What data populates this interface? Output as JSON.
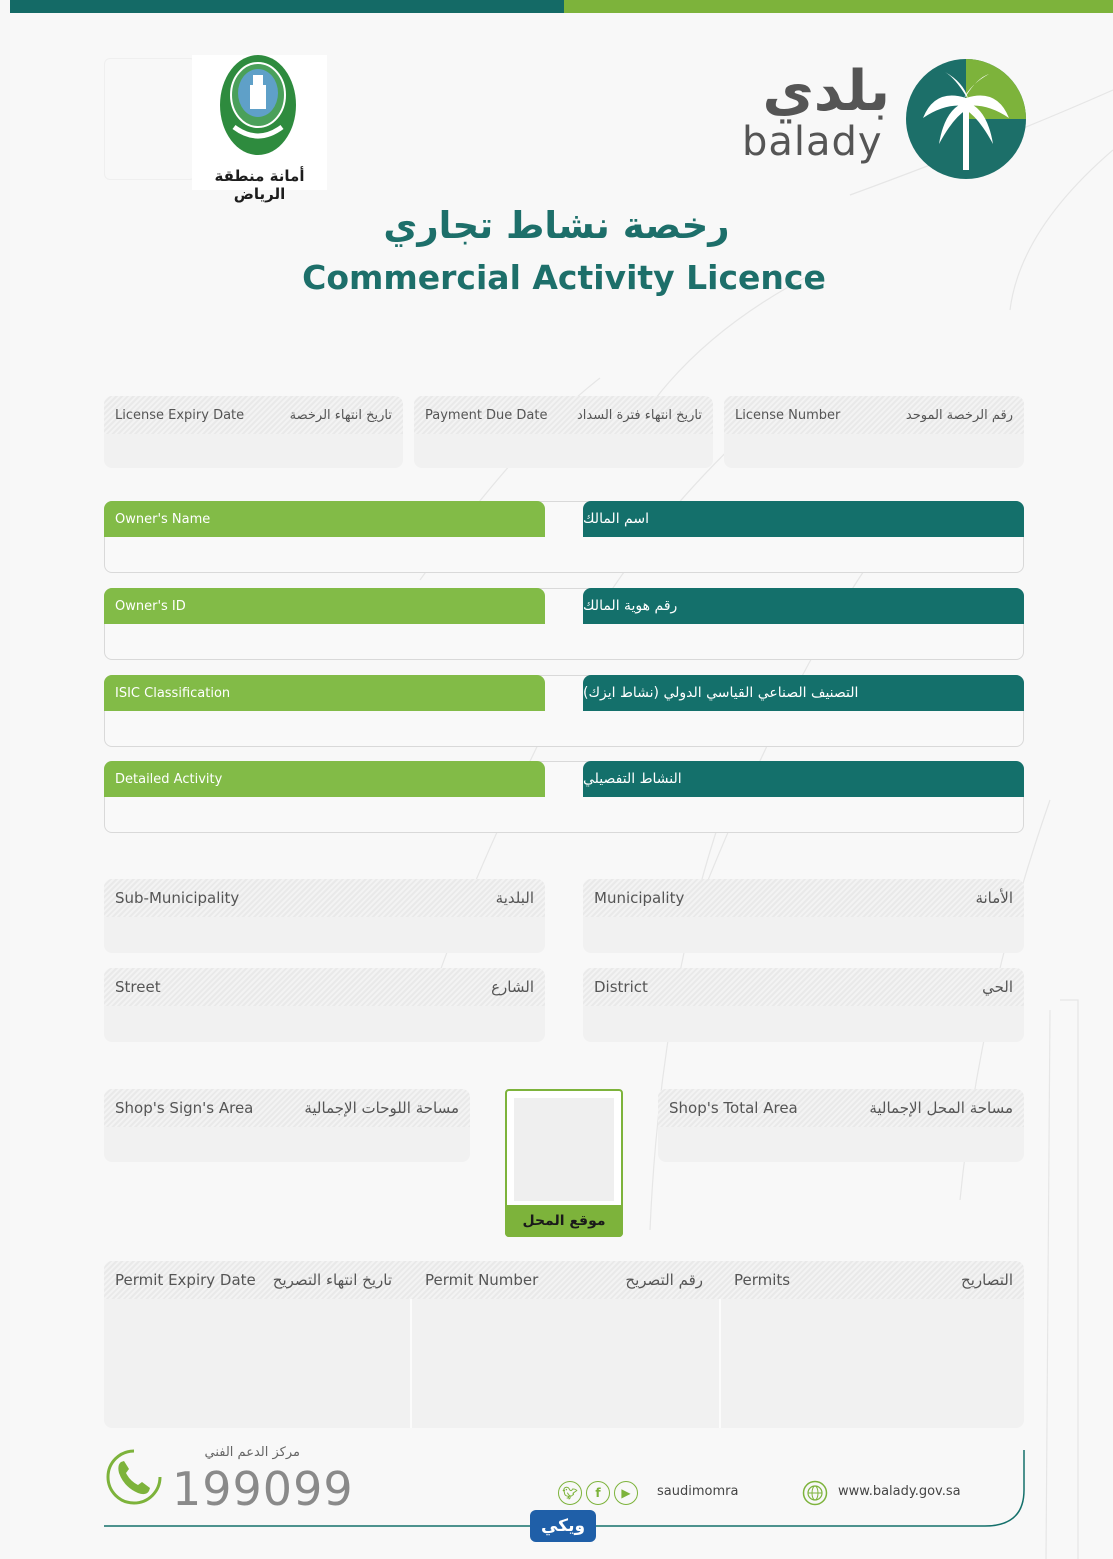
{
  "header": {
    "riyadh_name": "أمانة منطقة الرياض",
    "riyadh_emblem_text": "الرياض",
    "balady_ar": "بلدي",
    "balady_en": "balady"
  },
  "title": {
    "ar": "رخصة نشاط تجاري",
    "en": "Commercial Activity Licence"
  },
  "top_fields": [
    {
      "en": "License Expiry Date",
      "ar": "تاريخ انتهاء الرخصة"
    },
    {
      "en": "Payment Due Date",
      "ar": "تاريخ انتهاء فترة السداد"
    },
    {
      "en": "License Number",
      "ar": "رقم الرخصة الموحد"
    }
  ],
  "owner_fields": [
    {
      "en": "Owner's Name",
      "ar": "اسم المالك"
    },
    {
      "en": "Owner's ID",
      "ar": "رقم هوية المالك"
    },
    {
      "en": "ISIC Classification",
      "ar": "التصنيف الصناعي القياسي الدولي (نشاط ايزك)"
    },
    {
      "en": "Detailed Activity",
      "ar": "النشاط التفصيلي"
    }
  ],
  "address_fields": {
    "sub_municipality": {
      "en": "Sub-Municipality",
      "ar": "البلدية"
    },
    "municipality": {
      "en": "Municipality",
      "ar": "الأمانة"
    },
    "street": {
      "en": "Street",
      "ar": "الشارع"
    },
    "district": {
      "en": "District",
      "ar": "الحي"
    }
  },
  "area_fields": {
    "sign_area": {
      "en": "Shop's Sign's Area",
      "ar": "مساحة اللوحات الإجمالية"
    },
    "total_area": {
      "en": "Shop's Total Area",
      "ar": "مساحة المحل الإجمالية"
    },
    "location_caption": "موقع المحل"
  },
  "permits": {
    "expiry": {
      "en": "Permit Expiry Date",
      "ar": "تاريخ انتهاء التصريح"
    },
    "number": {
      "en": "Permit Number",
      "ar": "رقم التصريح"
    },
    "permits": {
      "en": "Permits",
      "ar": "التصاريح"
    }
  },
  "footer": {
    "support_label": "مركز الدعم الفني",
    "support_number": "199099",
    "social_handle": "saudimomra",
    "website": "www.balady.gov.sa",
    "badge": "ويكي"
  },
  "colors": {
    "teal": "#14706b",
    "green": "#82bb47",
    "title": "#1d6f6a"
  }
}
